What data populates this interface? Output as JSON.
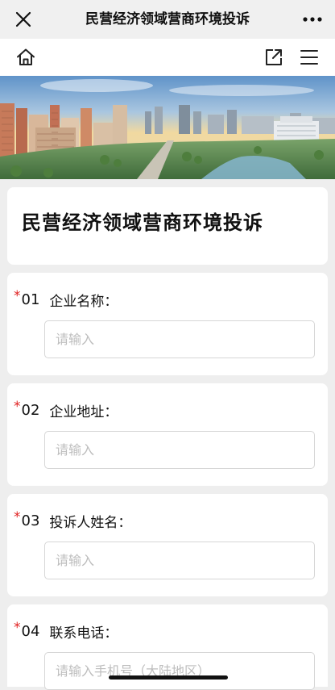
{
  "topbar": {
    "title": "民营经济领域营商环境投诉",
    "close_icon": "close-icon",
    "more_icon": "more-icon"
  },
  "toolbar": {
    "home_icon": "home-icon",
    "share_icon": "share-icon",
    "menu_icon": "menu-icon"
  },
  "form": {
    "title": "民营经济领域营商环境投诉",
    "questions": [
      {
        "required": "*",
        "number": "01",
        "label": "企业名称：",
        "placeholder": "请输入"
      },
      {
        "required": "*",
        "number": "02",
        "label": "企业地址：",
        "placeholder": "请输入"
      },
      {
        "required": "*",
        "number": "03",
        "label": "投诉人姓名：",
        "placeholder": "请输入"
      },
      {
        "required": "*",
        "number": "04",
        "label": "联系电话：",
        "placeholder": "请输入手机号（大陆地区）"
      }
    ]
  },
  "colors": {
    "required": "#e02020",
    "background": "#eeeeee",
    "card": "#ffffff"
  }
}
